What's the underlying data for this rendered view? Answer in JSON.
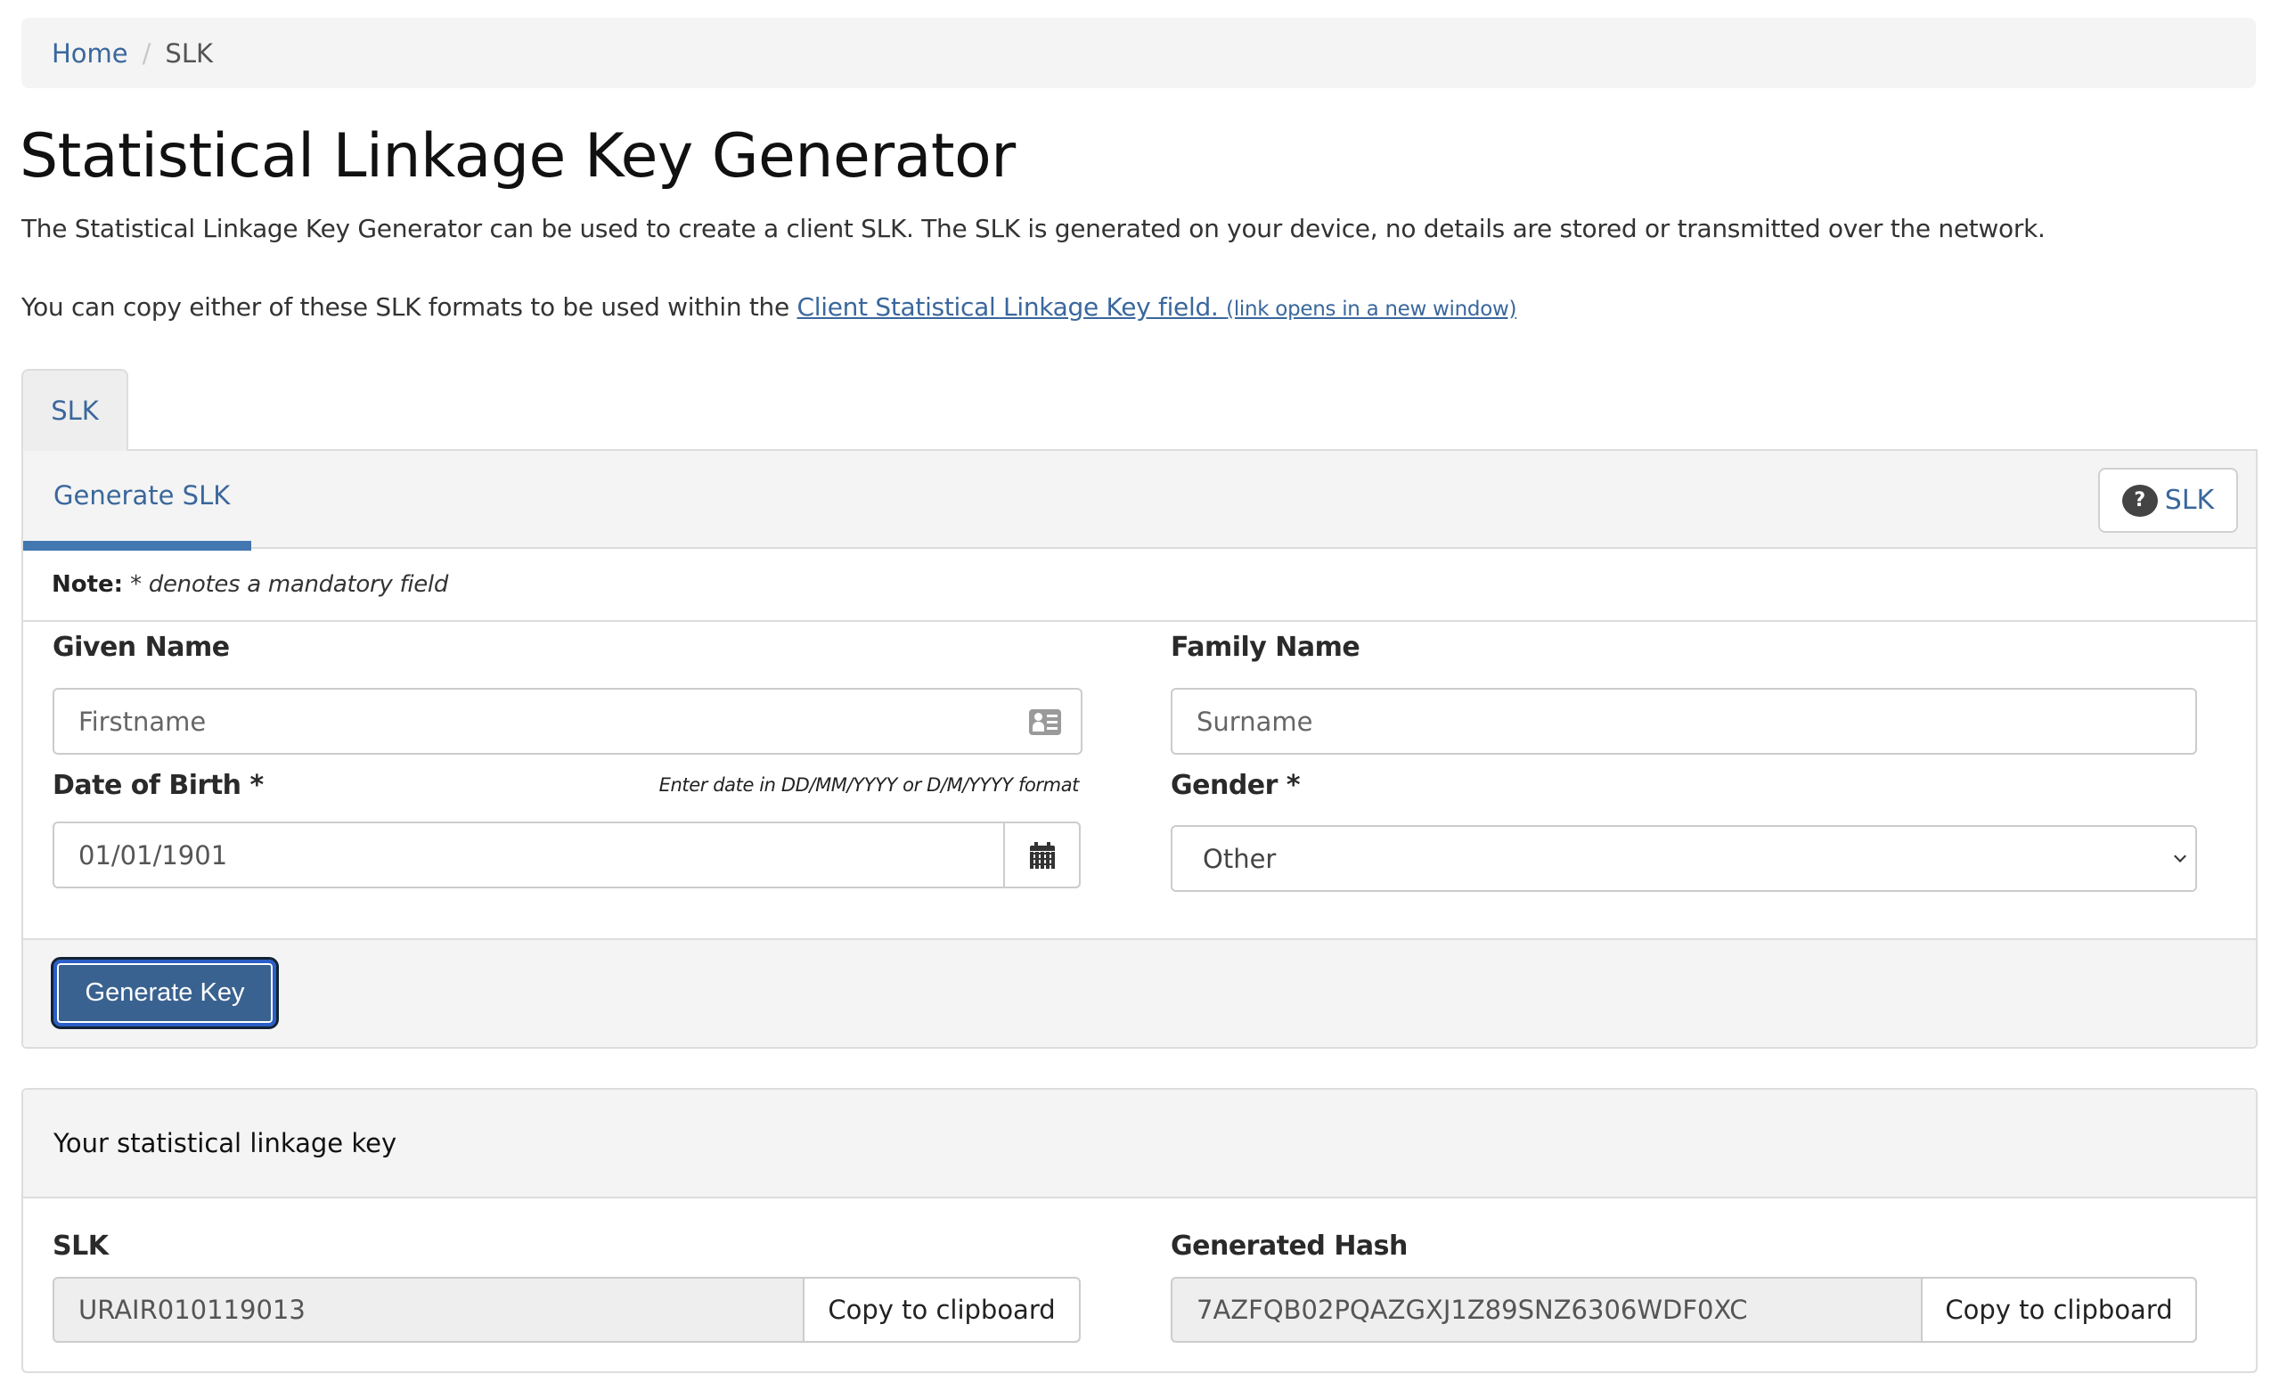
{
  "breadcrumb": {
    "home": "Home",
    "separator": "/",
    "current": "SLK"
  },
  "page": {
    "title": "Statistical Linkage Key Generator",
    "intro": "The Statistical Linkage Key Generator can be used to create a client SLK. The SLK is generated on your device, no details are stored or transmitted over the network.",
    "copy_prefix": "You can copy either of these SLK formats to be used within the ",
    "copy_link": "Client Statistical Linkage Key field.",
    "copy_link_note": "(link opens in a new window)"
  },
  "tabs": [
    {
      "label": "SLK",
      "active": true
    }
  ],
  "generator": {
    "subtab_label": "Generate SLK",
    "help_button_label": "SLK",
    "help_icon": "question-circle-icon",
    "note_label": "Note:",
    "note_text": "* denotes a mandatory field",
    "given_name": {
      "label": "Given Name",
      "placeholder": "Firstname",
      "value": "",
      "icon": "id-card-icon"
    },
    "family_name": {
      "label": "Family Name",
      "placeholder": "Surname",
      "value": ""
    },
    "dob": {
      "label": "Date of Birth *",
      "hint": "Enter date in DD/MM/YYYY or D/M/YYYY format",
      "value": "01/01/1901",
      "icon": "calendar-icon"
    },
    "gender": {
      "label": "Gender *",
      "selected": "Other"
    },
    "generate_button": "Generate Key"
  },
  "result": {
    "header": "Your statistical linkage key",
    "slk": {
      "label": "SLK",
      "value": "URAIR010119013",
      "copy_label": "Copy to clipboard"
    },
    "hash": {
      "label": "Generated Hash",
      "value": "7AZFQB02PQAZGXJ1Z89SNZ6306WDF0XC",
      "copy_label": "Copy to clipboard"
    }
  },
  "colors": {
    "link": "#3a679c",
    "primary_button": "#3a6290",
    "active_tab_bar": "#4377b0",
    "panel_bg": "#f4f4f4"
  }
}
